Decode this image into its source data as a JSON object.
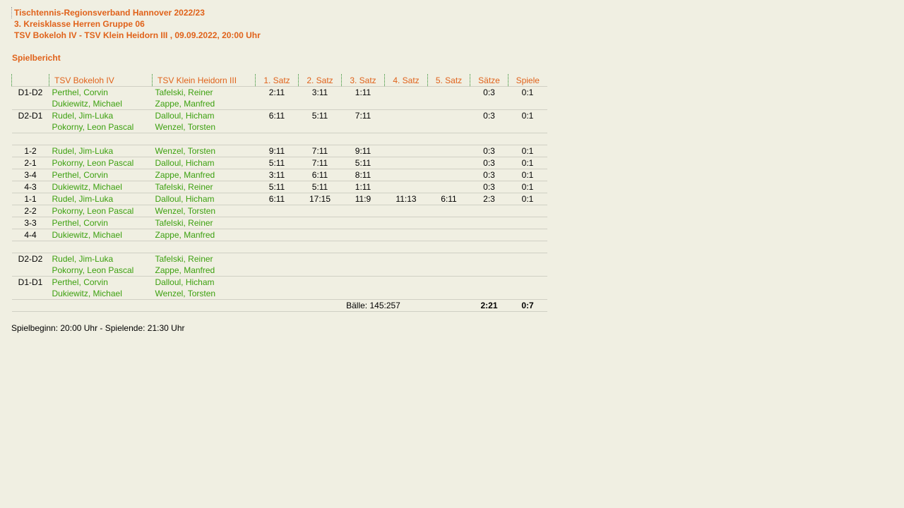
{
  "header": {
    "league": "Tischtennis-Regionsverband Hannover 2022/23",
    "group": "3. Kreisklasse Herren Gruppe 06",
    "match": "TSV Bokeloh IV - TSV Klein Heidorn III , 09.09.2022, 20:00 Uhr"
  },
  "report_title": "Spielbericht",
  "columns": {
    "pair": "",
    "home": "TSV Bokeloh IV",
    "away": "TSV Klein Heidorn III",
    "set1": "1. Satz",
    "set2": "2. Satz",
    "set3": "3. Satz",
    "set4": "4. Satz",
    "set5": "5. Satz",
    "sets": "Sätze",
    "games": "Spiele"
  },
  "doubles_a": [
    {
      "pair": "D1-D2",
      "home": [
        "Perthel, Corvin",
        "Dukiewitz, Michael"
      ],
      "away": [
        "Tafelski, Reiner",
        "Zappe, Manfred"
      ],
      "s1": "2:11",
      "s2": "3:11",
      "s3": "1:11",
      "s4": "",
      "s5": "",
      "sets": "0:3",
      "games": "0:1"
    },
    {
      "pair": "D2-D1",
      "home": [
        "Rudel, Jim-Luka",
        "Pokorny, Leon Pascal"
      ],
      "away": [
        "Dalloul, Hicham",
        "Wenzel, Torsten"
      ],
      "s1": "6:11",
      "s2": "5:11",
      "s3": "7:11",
      "s4": "",
      "s5": "",
      "sets": "0:3",
      "games": "0:1"
    }
  ],
  "singles": [
    {
      "pair": "1-2",
      "home": "Rudel, Jim-Luka",
      "away": "Wenzel, Torsten",
      "s1": "9:11",
      "s2": "7:11",
      "s3": "9:11",
      "s4": "",
      "s5": "",
      "sets": "0:3",
      "games": "0:1"
    },
    {
      "pair": "2-1",
      "home": "Pokorny, Leon Pascal",
      "away": "Dalloul, Hicham",
      "s1": "5:11",
      "s2": "7:11",
      "s3": "5:11",
      "s4": "",
      "s5": "",
      "sets": "0:3",
      "games": "0:1"
    },
    {
      "pair": "3-4",
      "home": "Perthel, Corvin",
      "away": "Zappe, Manfred",
      "s1": "3:11",
      "s2": "6:11",
      "s3": "8:11",
      "s4": "",
      "s5": "",
      "sets": "0:3",
      "games": "0:1"
    },
    {
      "pair": "4-3",
      "home": "Dukiewitz, Michael",
      "away": "Tafelski, Reiner",
      "s1": "5:11",
      "s2": "5:11",
      "s3": "1:11",
      "s4": "",
      "s5": "",
      "sets": "0:3",
      "games": "0:1"
    },
    {
      "pair": "1-1",
      "home": "Rudel, Jim-Luka",
      "away": "Dalloul, Hicham",
      "s1": "6:11",
      "s2": "17:15",
      "s3": "11:9",
      "s4": "11:13",
      "s5": "6:11",
      "sets": "2:3",
      "games": "0:1"
    },
    {
      "pair": "2-2",
      "home": "Pokorny, Leon Pascal",
      "away": "Wenzel, Torsten",
      "s1": "",
      "s2": "",
      "s3": "",
      "s4": "",
      "s5": "",
      "sets": "",
      "games": ""
    },
    {
      "pair": "3-3",
      "home": "Perthel, Corvin",
      "away": "Tafelski, Reiner",
      "s1": "",
      "s2": "",
      "s3": "",
      "s4": "",
      "s5": "",
      "sets": "",
      "games": ""
    },
    {
      "pair": "4-4",
      "home": "Dukiewitz, Michael",
      "away": "Zappe, Manfred",
      "s1": "",
      "s2": "",
      "s3": "",
      "s4": "",
      "s5": "",
      "sets": "",
      "games": ""
    }
  ],
  "doubles_b": [
    {
      "pair": "D2-D2",
      "home": [
        "Rudel, Jim-Luka",
        "Pokorny, Leon Pascal"
      ],
      "away": [
        "Tafelski, Reiner",
        "Zappe, Manfred"
      ],
      "s1": "",
      "s2": "",
      "s3": "",
      "s4": "",
      "s5": "",
      "sets": "",
      "games": ""
    },
    {
      "pair": "D1-D1",
      "home": [
        "Perthel, Corvin",
        "Dukiewitz, Michael"
      ],
      "away": [
        "Dalloul, Hicham",
        "Wenzel, Torsten"
      ],
      "s1": "",
      "s2": "",
      "s3": "",
      "s4": "",
      "s5": "",
      "sets": "",
      "games": ""
    }
  ],
  "totals": {
    "balls": "Bälle: 145:257",
    "sets": "2:21",
    "games": "0:7"
  },
  "footer": "Spielbeginn: 20:00 Uhr - Spielende: 21:30 Uhr"
}
